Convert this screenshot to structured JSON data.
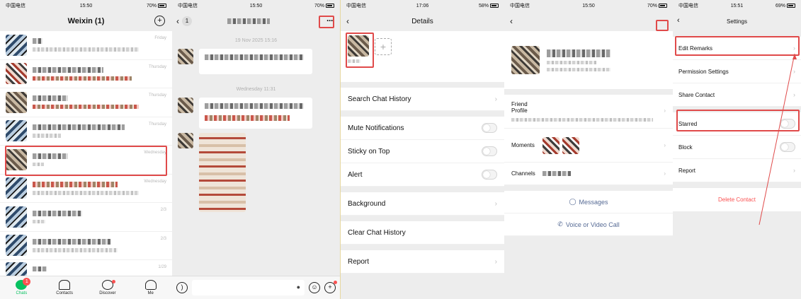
{
  "panel1": {
    "status": {
      "carrier": "中国电信",
      "time": "15:50",
      "battery": "70%"
    },
    "title": "Weixin (1)",
    "chats": [
      {
        "time": "Friday"
      },
      {
        "time": "Thursday"
      },
      {
        "time": "Thursday"
      },
      {
        "time": "Thursday"
      },
      {
        "time": "Wednesday"
      },
      {
        "time": "Wednesday"
      },
      {
        "time": "2/3"
      },
      {
        "time": "2/3"
      },
      {
        "time": "1/29"
      }
    ],
    "tabs": [
      {
        "label": "Chats",
        "badge": "1"
      },
      {
        "label": "Contacts"
      },
      {
        "label": "Discover"
      },
      {
        "label": "Me"
      }
    ]
  },
  "panel2": {
    "status": {
      "carrier": "中国电信",
      "time": "15:50",
      "battery": "70%"
    },
    "back_count": "1",
    "timestamps": [
      "19 Nov 2025 15:16",
      "Wednesday 11:31"
    ]
  },
  "panel3": {
    "status": {
      "carrier": "中国电信",
      "time": "17:06",
      "battery": "58%"
    },
    "title": "Details",
    "rows": {
      "search": "Search Chat History",
      "mute": "Mute Notifications",
      "sticky": "Sticky on Top",
      "alert": "Alert",
      "background": "Background",
      "clear": "Clear Chat History",
      "report": "Report"
    }
  },
  "panel4": {
    "status": {
      "carrier": "中国电信",
      "time": "15:50",
      "battery": "70%"
    },
    "friend_profile": "Friend Profile",
    "moments": "Moments",
    "channels": "Channels",
    "messages": "Messages",
    "call": "Voice or Video Call"
  },
  "panel5": {
    "status": {
      "carrier": "中国电信",
      "time": "15:51",
      "battery": "69%"
    },
    "title": "Settings",
    "rows": {
      "edit": "Edit Remarks",
      "permission": "Permission Settings",
      "share": "Share Contact",
      "starred": "Starred",
      "block": "Block",
      "report": "Report"
    },
    "delete": "Delete Contact"
  }
}
